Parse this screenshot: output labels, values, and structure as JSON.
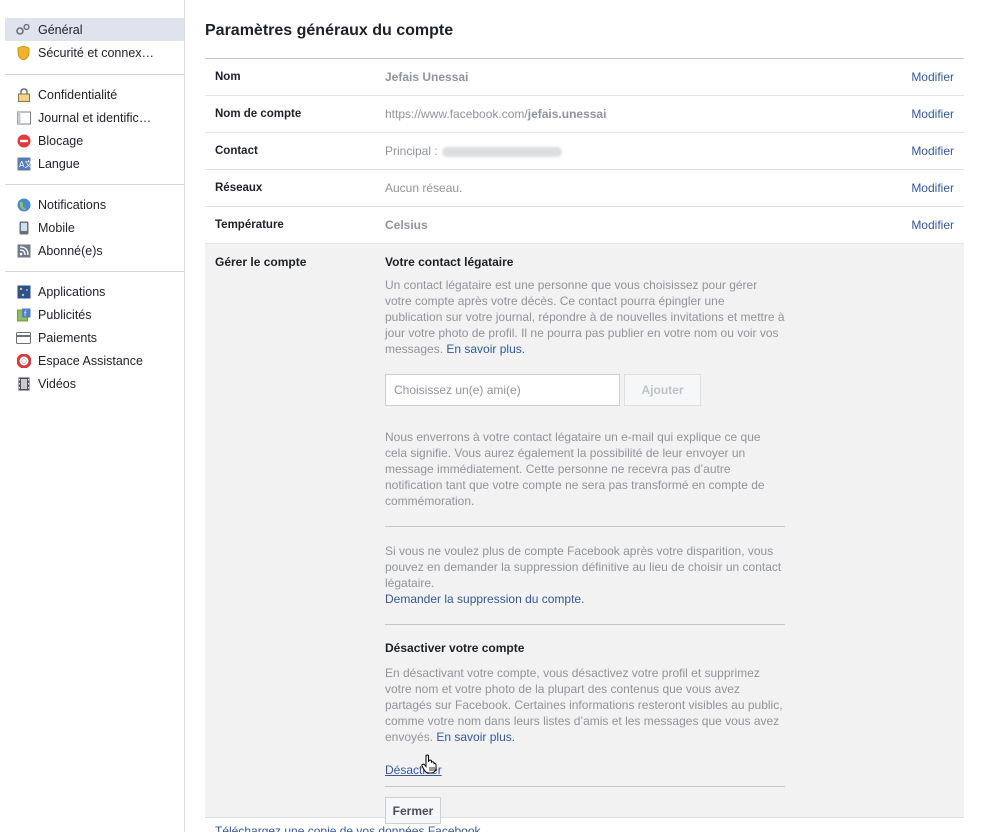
{
  "sidebar": {
    "groups": [
      [
        {
          "label": "Général",
          "icon": "gears-icon",
          "active": true
        },
        {
          "label": "Sécurité et connex…",
          "icon": "badge-icon"
        }
      ],
      [
        {
          "label": "Confidentialité",
          "icon": "lock-icon"
        },
        {
          "label": "Journal et identific…",
          "icon": "timeline-icon"
        },
        {
          "label": "Blocage",
          "icon": "block-icon"
        },
        {
          "label": "Langue",
          "icon": "language-icon"
        }
      ],
      [
        {
          "label": "Notifications",
          "icon": "globe-icon"
        },
        {
          "label": "Mobile",
          "icon": "mobile-icon"
        },
        {
          "label": "Abonné(e)s",
          "icon": "rss-icon"
        }
      ],
      [
        {
          "label": "Applications",
          "icon": "apps-icon"
        },
        {
          "label": "Publicités",
          "icon": "ads-icon"
        },
        {
          "label": "Paiements",
          "icon": "card-icon"
        },
        {
          "label": "Espace Assistance",
          "icon": "lifebuoy-icon"
        },
        {
          "label": "Vidéos",
          "icon": "film-icon"
        }
      ]
    ]
  },
  "main": {
    "title": "Paramètres généraux du compte",
    "edit_label": "Modifier",
    "rows": {
      "name": {
        "label": "Nom",
        "value": "Jefais Unessai"
      },
      "username": {
        "label": "Nom de compte",
        "value_prefix": "https://www.facebook.com/",
        "value_bold": "jefais.unessai"
      },
      "contact": {
        "label": "Contact",
        "value": "Principal :"
      },
      "networks": {
        "label": "Réseaux",
        "value": "Aucun réseau."
      },
      "temperature": {
        "label": "Température",
        "value": "Celsius"
      }
    },
    "manage": {
      "label": "Gérer le compte",
      "legacy_title": "Votre contact légataire",
      "legacy_text": "Un contact légataire est une personne que vous choisissez pour gérer votre compte après votre décès. Ce contact pourra épingler une publication sur votre journal, répondre à de nouvelles invitations et mettre à jour votre photo de profil. Il ne pourra pas publier en votre nom ou voir vos messages.",
      "learn_more": "En savoir plus.",
      "friend_placeholder": "Choisissez un(e) ami(e)",
      "add_button": "Ajouter",
      "notify_text": "Nous enverrons à votre contact légataire un e-mail qui explique ce que cela signifie. Vous aurez également la possibilité de leur envoyer un message immédiatement. Cette personne ne recevra pas d’autre notification tant que votre compte ne sera pas transformé en compte de commémoration.",
      "delete_text": "Si vous ne voulez plus de compte Facebook après votre disparition, vous pouvez en demander la suppression définitive au lieu de choisir un contact légataire.",
      "delete_link": "Demander la suppression du compte.",
      "deactivate_title": "Désactiver votre compte",
      "deactivate_text": "En désactivant votre compte, vous désactivez votre profil et supprimez votre nom et votre photo de la plupart des contenus que vous avez partagés sur Facebook. Certaines informations resteront visibles au public, comme votre nom dans leurs listes d’amis et les messages que vous avez envoyés.",
      "deactivate_link": "Désactiver",
      "close_button": "Fermer"
    },
    "bottom_link": "Téléchargez une copie de vos données Facebook."
  }
}
